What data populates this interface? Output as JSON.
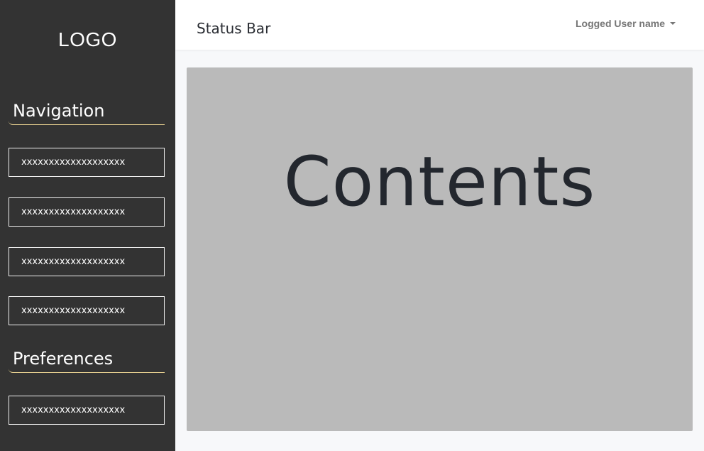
{
  "sidebar": {
    "logo": "LOGO",
    "navigation_title": "Navigation",
    "nav_items": [
      {
        "label": "xxxxxxxxxxxxxxxxxxx"
      },
      {
        "label": "xxxxxxxxxxxxxxxxxxx"
      },
      {
        "label": "xxxxxxxxxxxxxxxxxxx"
      },
      {
        "label": "xxxxxxxxxxxxxxxxxxx"
      }
    ],
    "preferences_title": "Preferences",
    "pref_items": [
      {
        "label": "xxxxxxxxxxxxxxxxxxx"
      }
    ]
  },
  "topbar": {
    "title": "Status Bar",
    "user": "Logged User name"
  },
  "main": {
    "placeholder": "Contents"
  },
  "colors": {
    "sidebar_bg": "#333333",
    "accent_underline": "#e6cf8f",
    "content_bg": "#bababa"
  }
}
